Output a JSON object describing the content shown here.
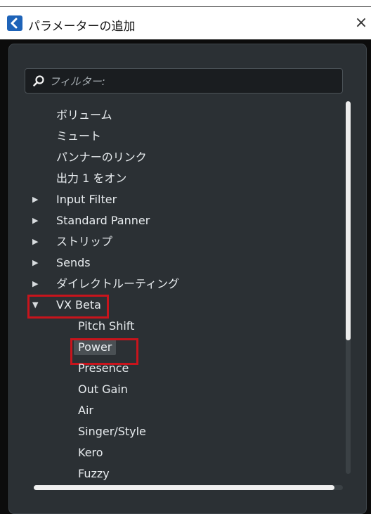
{
  "window": {
    "title": "パラメーターの追加",
    "close_glyph": "×"
  },
  "filter": {
    "placeholder": "フィルター:"
  },
  "tree": {
    "items": [
      {
        "label": "ボリューム"
      },
      {
        "label": "ミュート"
      },
      {
        "label": "パンナーのリンク"
      },
      {
        "label": "出力 1 をオン"
      },
      {
        "label": "Input Filter",
        "arrow": "▶"
      },
      {
        "label": "Standard Panner",
        "arrow": "▶"
      },
      {
        "label": "ストリップ",
        "arrow": "▶"
      },
      {
        "label": "Sends",
        "arrow": "▶"
      },
      {
        "label": "ダイレクトルーティング",
        "arrow": "▶"
      },
      {
        "label": "VX Beta",
        "arrow": "▼"
      }
    ],
    "children": [
      {
        "label": "Pitch Shift"
      },
      {
        "label": "Power"
      },
      {
        "label": "Presence"
      },
      {
        "label": "Out Gain"
      },
      {
        "label": "Air"
      },
      {
        "label": "Singer/Style"
      },
      {
        "label": "Kero"
      },
      {
        "label": "Fuzzy"
      }
    ]
  },
  "colors": {
    "highlight_box": "#c8141c",
    "panel_bg": "#2b3034",
    "text": "#e8ecef"
  }
}
